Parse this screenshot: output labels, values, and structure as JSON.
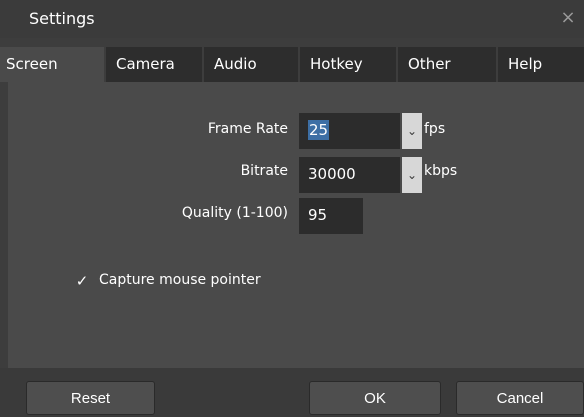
{
  "window": {
    "title": "Settings",
    "close_glyph": "×"
  },
  "tabs": [
    {
      "label": "Screen",
      "active": true
    },
    {
      "label": "Camera",
      "active": false
    },
    {
      "label": "Audio",
      "active": false
    },
    {
      "label": "Hotkey",
      "active": false
    },
    {
      "label": "Other",
      "active": false
    },
    {
      "label": "Help",
      "active": false
    }
  ],
  "screen": {
    "frame_rate": {
      "label": "Frame Rate",
      "value": "25",
      "unit": "fps"
    },
    "bitrate": {
      "label": "Bitrate",
      "value": "30000",
      "unit": "kbps"
    },
    "quality": {
      "label": "Quality (1-100)",
      "value": "95"
    },
    "capture_mouse": {
      "label": "Capture mouse pointer",
      "checked": true,
      "check_glyph": "✓"
    }
  },
  "footer": {
    "reset_label": "Reset",
    "ok_label": "OK",
    "cancel_label": "Cancel"
  },
  "icons": {
    "dropdown": "chevron-down-icon",
    "close": "close-icon",
    "check": "check-icon"
  },
  "colors": {
    "window_bg": "#3d3d3d",
    "panel_bg": "#4a4a4a",
    "tab_inactive_bg": "#2d2d2d",
    "field_bg": "#2c2c2c",
    "selection": "#3d6fa5"
  }
}
